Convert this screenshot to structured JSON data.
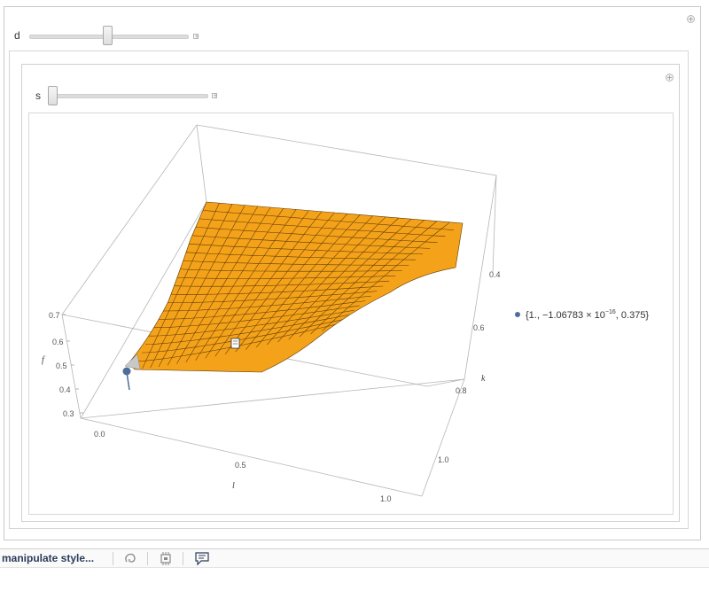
{
  "manipulate": {
    "outer_control": {
      "label": "d",
      "value": 0.5
    },
    "inner_control": {
      "label": "s",
      "value": 0.0
    }
  },
  "plot": {
    "x_axis_label": "l",
    "y_axis_label": "k",
    "z_axis_label": "f",
    "x_ticks": [
      "0.0",
      "0.5",
      "1.0"
    ],
    "y_ticks": [
      "0.4",
      "0.6",
      "0.8",
      "1.0"
    ],
    "z_ticks": [
      "0.7",
      "0.6",
      "0.5",
      "0.4",
      "0.3"
    ],
    "surface_color": "#f5a21b",
    "mesh_color": "#5a3b00",
    "point_color": "#4f6d9a"
  },
  "legend": {
    "text": "{1., −1.06783 × 10",
    "exponent": "−16",
    "text_tail": ", 0.375}"
  },
  "toolbar": {
    "label": "manipulate style...",
    "icons": [
      "swirl-icon",
      "chip-icon",
      "comment-icon"
    ]
  }
}
